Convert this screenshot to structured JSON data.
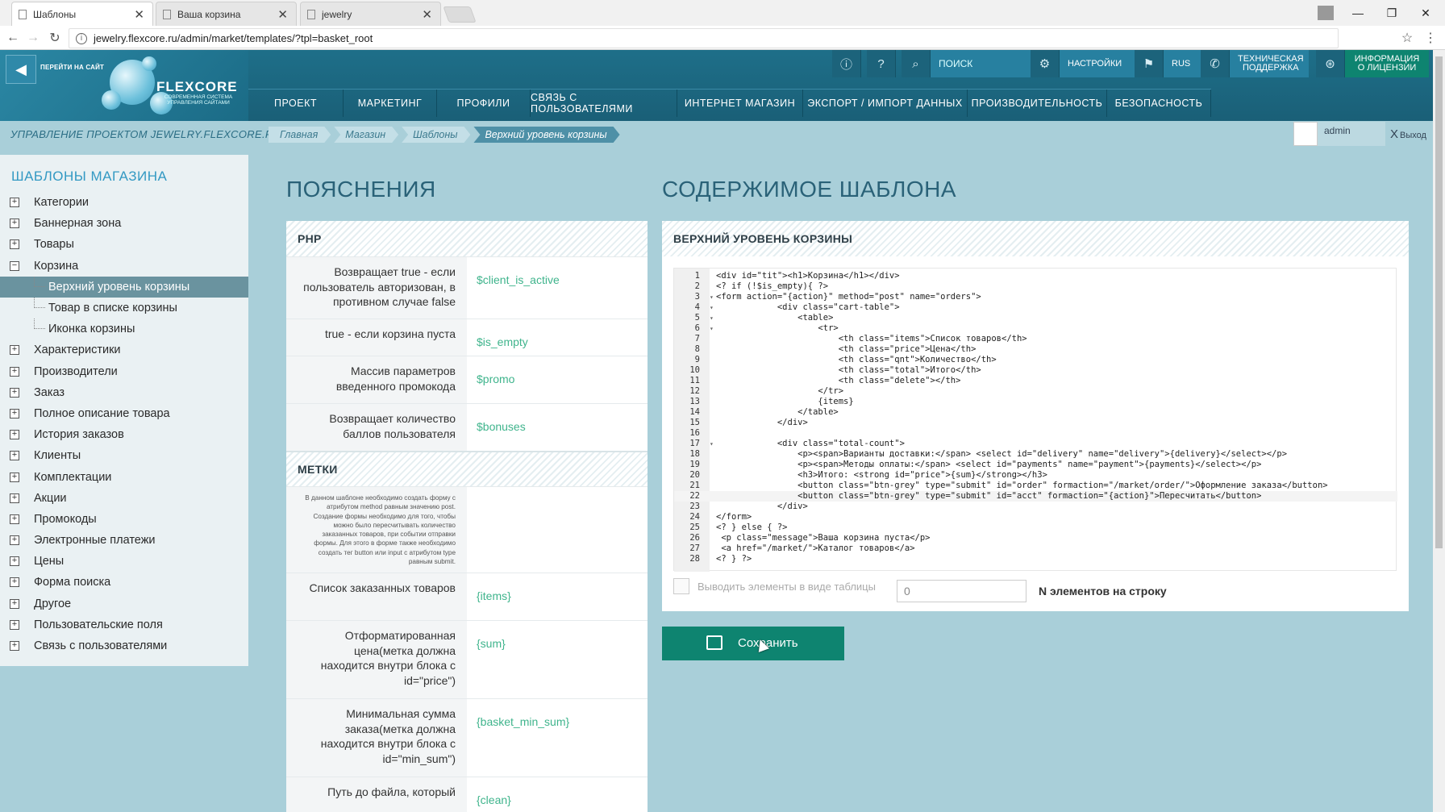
{
  "browser": {
    "tabs": [
      {
        "label": "Шаблоны",
        "active": true
      },
      {
        "label": "Ваша корзина",
        "active": false
      },
      {
        "label": "jewelry",
        "active": false
      }
    ],
    "url": "jewelry.flexcore.ru/admin/market/templates/?tpl=basket_root"
  },
  "header": {
    "go_site": "ПЕРЕЙТИ НА САЙТ",
    "logo": "FLEXCORE",
    "logo_sub": "СОВРЕМЕННАЯ СИСТЕМА УПРАВЛЕНИЯ САЙТАМИ",
    "search_placeholder": "ПОИСК",
    "settings": "НАСТРОЙКИ",
    "lang": "RUS",
    "support": "ТЕХНИЧЕСКАЯ ПОДДЕРЖКА",
    "license": "ИНФОРМАЦИЯ О ЛИЦЕНЗИИ",
    "nav": [
      "ПРОЕКТ",
      "МАРКЕТИНГ",
      "ПРОФИЛИ",
      "СВЯЗЬ С ПОЛЬЗОВАТЕЛЯМИ",
      "ИНТЕРНЕТ МАГАЗИН",
      "ЭКСПОРТ / ИМПОРТ ДАННЫХ",
      "ПРОИЗВОДИТЕЛЬНОСТЬ",
      "БЕЗОПАСНОСТЬ"
    ]
  },
  "crumbbar": {
    "project": "УПРАВЛЕНИЕ ПРОЕКТОМ JEWELRY.FLEXCORE.RU",
    "crumbs": [
      "Главная",
      "Магазин",
      "Шаблоны",
      "Верхний уровень корзины"
    ],
    "user": "admin",
    "logout": "Выход"
  },
  "sidebar": {
    "title": "ШАБЛОНЫ МАГАЗИНА",
    "items": [
      {
        "label": "Категории",
        "level": 0,
        "sign": "+"
      },
      {
        "label": "Баннерная зона",
        "level": 0,
        "sign": "+"
      },
      {
        "label": "Товары",
        "level": 0,
        "sign": "+"
      },
      {
        "label": "Корзина",
        "level": 0,
        "sign": "−"
      },
      {
        "label": "Верхний уровень корзины",
        "level": 1,
        "selected": true
      },
      {
        "label": "Товар в списке корзины",
        "level": 1
      },
      {
        "label": "Иконка корзины",
        "level": 1
      },
      {
        "label": "Характеристики",
        "level": 0,
        "sign": "+"
      },
      {
        "label": "Производители",
        "level": 0,
        "sign": "+"
      },
      {
        "label": "Заказ",
        "level": 0,
        "sign": "+"
      },
      {
        "label": "Полное описание товара",
        "level": 0,
        "sign": "+"
      },
      {
        "label": "История заказов",
        "level": 0,
        "sign": "+"
      },
      {
        "label": "Клиенты",
        "level": 0,
        "sign": "+"
      },
      {
        "label": "Комплектации",
        "level": 0,
        "sign": "+"
      },
      {
        "label": "Акции",
        "level": 0,
        "sign": "+"
      },
      {
        "label": "Промокоды",
        "level": 0,
        "sign": "+"
      },
      {
        "label": "Электронные платежи",
        "level": 0,
        "sign": "+"
      },
      {
        "label": "Цены",
        "level": 0,
        "sign": "+"
      },
      {
        "label": "Форма поиска",
        "level": 0,
        "sign": "+"
      },
      {
        "label": "Другое",
        "level": 0,
        "sign": "+"
      },
      {
        "label": "Пользовательские поля",
        "level": 0,
        "sign": "+"
      },
      {
        "label": "Связь с пользователями",
        "level": 0,
        "sign": "+"
      }
    ]
  },
  "explanations": {
    "title": "ПОЯСНЕНИЯ",
    "php_title": "PHP",
    "php_rows": [
      {
        "desc": "Возвращает true - если пользователь авторизован, в противном случае false",
        "var": "$client_is_active"
      },
      {
        "desc": "true - если корзина пуста",
        "var": "$is_empty"
      },
      {
        "desc": "Массив параметров введенного промокода",
        "var": "$promo"
      },
      {
        "desc": "Возвращает количество баллов пользователя",
        "var": "$bonuses"
      }
    ],
    "tags_title": "МЕТКИ",
    "tags_note": "В данном шаблоне необходимо создать форму с атрибутом method равным значению post. Создание формы необходимо для того, чтобы можно было пересчитывать количество заказанных товаров, при событии отправки формы. Для этого в форме также необходимо создать тег button или input с атрибутом type равным submit.",
    "tag_rows": [
      {
        "desc": "Список заказанных товаров",
        "var": "{items}"
      },
      {
        "desc": "Отформатированная цена(метка должна находится внутри блока с id=\"price\")",
        "var": "{sum}"
      },
      {
        "desc": "Минимальная сумма заказа(метка должна находится внутри блока с id=\"min_sum\")",
        "var": "{basket_min_sum}"
      },
      {
        "desc": "Путь до файла, который",
        "var": "{clean}"
      }
    ]
  },
  "content": {
    "title": "СОДЕРЖИМОЕ ШАБЛОНА",
    "panel_title": "ВЕРХНИЙ УРОВЕНЬ КОРЗИНЫ",
    "code_lines": [
      "<div id=\"tit\"><h1>Корзина</h1></div>",
      "<? if (!$is_empty){ ?>",
      "<form action=\"{action}\" method=\"post\" name=\"orders\">",
      "            <div class=\"cart-table\">",
      "                <table>",
      "                    <tr>",
      "                        <th class=\"items\">Список товаров</th>",
      "                        <th class=\"price\">Цена</th>",
      "                        <th class=\"qnt\">Количество</th>",
      "                        <th class=\"total\">Итого</th>",
      "                        <th class=\"delete\"></th>",
      "                    </tr>",
      "                    {items}",
      "                </table>",
      "            </div>",
      "",
      "            <div class=\"total-count\">",
      "                <p><span>Варианты доставки:</span> <select id=\"delivery\" name=\"delivery\">{delivery}</select></p>",
      "                <p><span>Методы оплаты:</span> <select id=\"payments\" name=\"payment\">{payments}</select></p>",
      "                <h3>Итого: <strong id=\"price\">{sum}</strong></h3>",
      "                <button class=\"btn-grey\" type=\"submit\" id=\"order\" formaction=\"/market/order/\">Оформление заказа</button>",
      "                <button class=\"btn-grey\" type=\"submit\" id=\"acct\" formaction=\"{action}\">Пересчитать</button>",
      "            </div>",
      "</form>",
      "<? } else { ?>",
      " <p class=\"message\">Ваша корзина пуста</p>",
      " <a href=\"/market/\">Каталог товаров</a>",
      "<? } ?>"
    ],
    "table_option_label": "Выводить элементы в виде таблицы",
    "n_value": "0",
    "n_label": "N элементов на строку",
    "save": "Сохранить"
  }
}
